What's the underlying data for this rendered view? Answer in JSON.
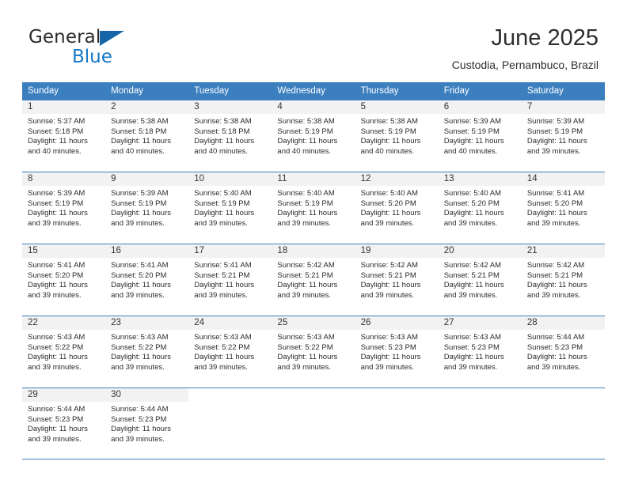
{
  "brand": {
    "name_top": "General",
    "name_bottom": "Blue",
    "triangle_color": "#1565a8",
    "blue_text_color": "#1577c6"
  },
  "header": {
    "title": "June 2025",
    "subtitle": "Custodia, Pernambuco, Brazil"
  },
  "theme": {
    "header_bg": "#3c7fbf",
    "header_text": "#ffffff",
    "daynum_bg": "#f2f2f2",
    "grid_line": "#3c7fbf",
    "body_text": "#2b2b2b"
  },
  "weekdays": [
    "Sunday",
    "Monday",
    "Tuesday",
    "Wednesday",
    "Thursday",
    "Friday",
    "Saturday"
  ],
  "labels": {
    "sunrise_prefix": "Sunrise: ",
    "sunset_prefix": "Sunset: ",
    "daylight_prefix": "Daylight: "
  },
  "weeks": [
    [
      {
        "day": "1",
        "sunrise": "Sunrise: 5:37 AM",
        "sunset": "Sunset: 5:18 PM",
        "daylight_a": "Daylight: 11 hours",
        "daylight_b": "and 40 minutes."
      },
      {
        "day": "2",
        "sunrise": "Sunrise: 5:38 AM",
        "sunset": "Sunset: 5:18 PM",
        "daylight_a": "Daylight: 11 hours",
        "daylight_b": "and 40 minutes."
      },
      {
        "day": "3",
        "sunrise": "Sunrise: 5:38 AM",
        "sunset": "Sunset: 5:18 PM",
        "daylight_a": "Daylight: 11 hours",
        "daylight_b": "and 40 minutes."
      },
      {
        "day": "4",
        "sunrise": "Sunrise: 5:38 AM",
        "sunset": "Sunset: 5:19 PM",
        "daylight_a": "Daylight: 11 hours",
        "daylight_b": "and 40 minutes."
      },
      {
        "day": "5",
        "sunrise": "Sunrise: 5:38 AM",
        "sunset": "Sunset: 5:19 PM",
        "daylight_a": "Daylight: 11 hours",
        "daylight_b": "and 40 minutes."
      },
      {
        "day": "6",
        "sunrise": "Sunrise: 5:39 AM",
        "sunset": "Sunset: 5:19 PM",
        "daylight_a": "Daylight: 11 hours",
        "daylight_b": "and 40 minutes."
      },
      {
        "day": "7",
        "sunrise": "Sunrise: 5:39 AM",
        "sunset": "Sunset: 5:19 PM",
        "daylight_a": "Daylight: 11 hours",
        "daylight_b": "and 39 minutes."
      }
    ],
    [
      {
        "day": "8",
        "sunrise": "Sunrise: 5:39 AM",
        "sunset": "Sunset: 5:19 PM",
        "daylight_a": "Daylight: 11 hours",
        "daylight_b": "and 39 minutes."
      },
      {
        "day": "9",
        "sunrise": "Sunrise: 5:39 AM",
        "sunset": "Sunset: 5:19 PM",
        "daylight_a": "Daylight: 11 hours",
        "daylight_b": "and 39 minutes."
      },
      {
        "day": "10",
        "sunrise": "Sunrise: 5:40 AM",
        "sunset": "Sunset: 5:19 PM",
        "daylight_a": "Daylight: 11 hours",
        "daylight_b": "and 39 minutes."
      },
      {
        "day": "11",
        "sunrise": "Sunrise: 5:40 AM",
        "sunset": "Sunset: 5:19 PM",
        "daylight_a": "Daylight: 11 hours",
        "daylight_b": "and 39 minutes."
      },
      {
        "day": "12",
        "sunrise": "Sunrise: 5:40 AM",
        "sunset": "Sunset: 5:20 PM",
        "daylight_a": "Daylight: 11 hours",
        "daylight_b": "and 39 minutes."
      },
      {
        "day": "13",
        "sunrise": "Sunrise: 5:40 AM",
        "sunset": "Sunset: 5:20 PM",
        "daylight_a": "Daylight: 11 hours",
        "daylight_b": "and 39 minutes."
      },
      {
        "day": "14",
        "sunrise": "Sunrise: 5:41 AM",
        "sunset": "Sunset: 5:20 PM",
        "daylight_a": "Daylight: 11 hours",
        "daylight_b": "and 39 minutes."
      }
    ],
    [
      {
        "day": "15",
        "sunrise": "Sunrise: 5:41 AM",
        "sunset": "Sunset: 5:20 PM",
        "daylight_a": "Daylight: 11 hours",
        "daylight_b": "and 39 minutes."
      },
      {
        "day": "16",
        "sunrise": "Sunrise: 5:41 AM",
        "sunset": "Sunset: 5:20 PM",
        "daylight_a": "Daylight: 11 hours",
        "daylight_b": "and 39 minutes."
      },
      {
        "day": "17",
        "sunrise": "Sunrise: 5:41 AM",
        "sunset": "Sunset: 5:21 PM",
        "daylight_a": "Daylight: 11 hours",
        "daylight_b": "and 39 minutes."
      },
      {
        "day": "18",
        "sunrise": "Sunrise: 5:42 AM",
        "sunset": "Sunset: 5:21 PM",
        "daylight_a": "Daylight: 11 hours",
        "daylight_b": "and 39 minutes."
      },
      {
        "day": "19",
        "sunrise": "Sunrise: 5:42 AM",
        "sunset": "Sunset: 5:21 PM",
        "daylight_a": "Daylight: 11 hours",
        "daylight_b": "and 39 minutes."
      },
      {
        "day": "20",
        "sunrise": "Sunrise: 5:42 AM",
        "sunset": "Sunset: 5:21 PM",
        "daylight_a": "Daylight: 11 hours",
        "daylight_b": "and 39 minutes."
      },
      {
        "day": "21",
        "sunrise": "Sunrise: 5:42 AM",
        "sunset": "Sunset: 5:21 PM",
        "daylight_a": "Daylight: 11 hours",
        "daylight_b": "and 39 minutes."
      }
    ],
    [
      {
        "day": "22",
        "sunrise": "Sunrise: 5:43 AM",
        "sunset": "Sunset: 5:22 PM",
        "daylight_a": "Daylight: 11 hours",
        "daylight_b": "and 39 minutes."
      },
      {
        "day": "23",
        "sunrise": "Sunrise: 5:43 AM",
        "sunset": "Sunset: 5:22 PM",
        "daylight_a": "Daylight: 11 hours",
        "daylight_b": "and 39 minutes."
      },
      {
        "day": "24",
        "sunrise": "Sunrise: 5:43 AM",
        "sunset": "Sunset: 5:22 PM",
        "daylight_a": "Daylight: 11 hours",
        "daylight_b": "and 39 minutes."
      },
      {
        "day": "25",
        "sunrise": "Sunrise: 5:43 AM",
        "sunset": "Sunset: 5:22 PM",
        "daylight_a": "Daylight: 11 hours",
        "daylight_b": "and 39 minutes."
      },
      {
        "day": "26",
        "sunrise": "Sunrise: 5:43 AM",
        "sunset": "Sunset: 5:23 PM",
        "daylight_a": "Daylight: 11 hours",
        "daylight_b": "and 39 minutes."
      },
      {
        "day": "27",
        "sunrise": "Sunrise: 5:43 AM",
        "sunset": "Sunset: 5:23 PM",
        "daylight_a": "Daylight: 11 hours",
        "daylight_b": "and 39 minutes."
      },
      {
        "day": "28",
        "sunrise": "Sunrise: 5:44 AM",
        "sunset": "Sunset: 5:23 PM",
        "daylight_a": "Daylight: 11 hours",
        "daylight_b": "and 39 minutes."
      }
    ],
    [
      {
        "day": "29",
        "sunrise": "Sunrise: 5:44 AM",
        "sunset": "Sunset: 5:23 PM",
        "daylight_a": "Daylight: 11 hours",
        "daylight_b": "and 39 minutes."
      },
      {
        "day": "30",
        "sunrise": "Sunrise: 5:44 AM",
        "sunset": "Sunset: 5:23 PM",
        "daylight_a": "Daylight: 11 hours",
        "daylight_b": "and 39 minutes."
      },
      {
        "day": "",
        "sunrise": "",
        "sunset": "",
        "daylight_a": "",
        "daylight_b": ""
      },
      {
        "day": "",
        "sunrise": "",
        "sunset": "",
        "daylight_a": "",
        "daylight_b": ""
      },
      {
        "day": "",
        "sunrise": "",
        "sunset": "",
        "daylight_a": "",
        "daylight_b": ""
      },
      {
        "day": "",
        "sunrise": "",
        "sunset": "",
        "daylight_a": "",
        "daylight_b": ""
      },
      {
        "day": "",
        "sunrise": "",
        "sunset": "",
        "daylight_a": "",
        "daylight_b": ""
      }
    ]
  ]
}
